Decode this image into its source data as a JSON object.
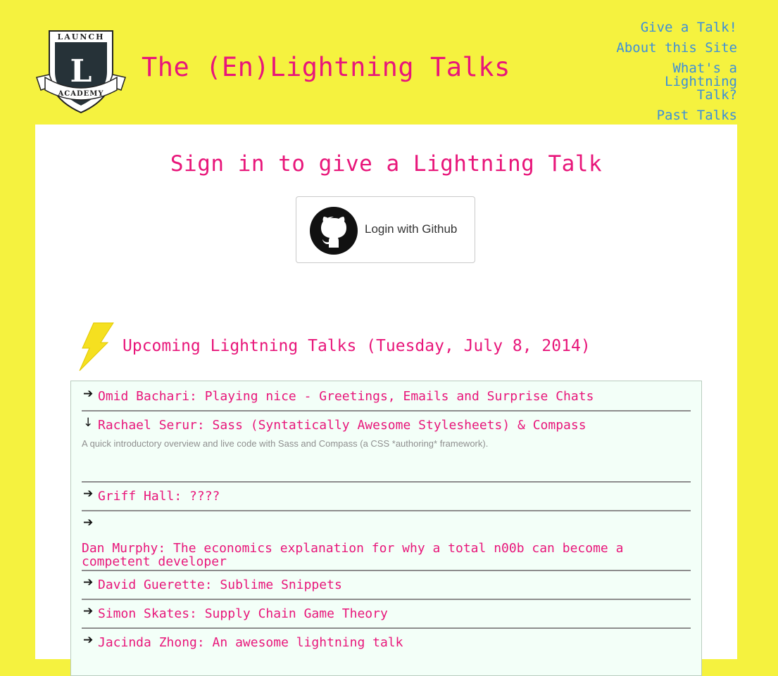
{
  "logo": {
    "top_text": "LAUNCH",
    "letter": "L",
    "bottom_text": "ACADEMY"
  },
  "site_title": "The (En)Lightning Talks",
  "nav": [
    {
      "label": "Give a Talk!"
    },
    {
      "label": "About this Site"
    },
    {
      "label": "What's a Lightning Talk?"
    },
    {
      "label": "Past Talks"
    }
  ],
  "signin": {
    "heading": "Sign in to give a Lightning Talk",
    "button_label": "Login with Github"
  },
  "upcoming": {
    "heading": "Upcoming Lightning Talks (Tuesday, July 8, 2014)",
    "talks": [
      {
        "arrow": "➔",
        "title": "Omid Bachari: Playing nice - Greetings, Emails and Surprise Chats",
        "description": ""
      },
      {
        "arrow": "↓",
        "title": "Rachael Serur: Sass (Syntatically Awesome Stylesheets) & Compass",
        "description": "A quick introductory overview and live code with Sass and Compass (a CSS *authoring* framework)."
      },
      {
        "arrow": "➔",
        "title": "Griff Hall: ????",
        "description": ""
      },
      {
        "arrow": "➔",
        "title": "Dan Murphy: The economics explanation for why a total n00b can become a competent developer",
        "description": ""
      },
      {
        "arrow": "➔",
        "title": "David Guerette: Sublime Snippets",
        "description": ""
      },
      {
        "arrow": "➔",
        "title": "Simon Skates: Supply Chain Game Theory",
        "description": ""
      },
      {
        "arrow": "➔",
        "title": "Jacinda Zhong: An awesome lightning talk",
        "description": ""
      }
    ]
  },
  "colors": {
    "background": "#f5f23f",
    "accent_pink": "#e8167a",
    "link_blue": "#3d8fd9",
    "list_bg": "#f3fff8"
  },
  "icons": {
    "logo": "launch-academy-shield-logo",
    "github": "github-octocat-icon",
    "bolt": "lightning-bolt-icon"
  }
}
